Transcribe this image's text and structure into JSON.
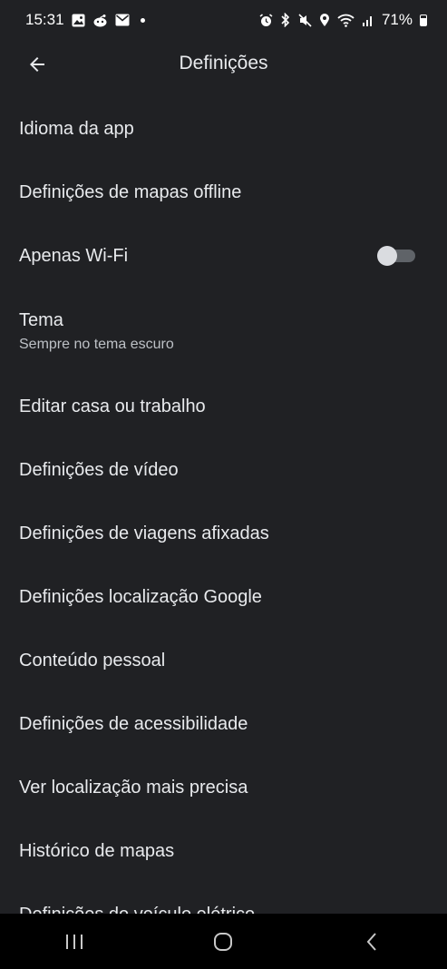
{
  "status_bar": {
    "time": "15:31",
    "battery_percent": "71%"
  },
  "app_bar": {
    "title": "Definições"
  },
  "settings": {
    "items": [
      {
        "label": "Idioma da app"
      },
      {
        "label": "Definições de mapas offline"
      },
      {
        "label": "Apenas Wi-Fi",
        "toggle_on": false
      },
      {
        "label": "Tema",
        "subtitle": "Sempre no tema escuro"
      },
      {
        "label": "Editar casa ou trabalho"
      },
      {
        "label": "Definições de vídeo"
      },
      {
        "label": "Definições de viagens afixadas"
      },
      {
        "label": "Definições localização Google"
      },
      {
        "label": "Conteúdo pessoal"
      },
      {
        "label": "Definições de acessibilidade"
      },
      {
        "label": "Ver localização mais precisa"
      },
      {
        "label": "Histórico de mapas"
      },
      {
        "label": "Definições do veículo elétrico"
      }
    ]
  },
  "colors": {
    "background": "#202124",
    "text_primary": "#e8eaed",
    "text_secondary": "#bdc1c6",
    "nav_bar": "#000000"
  }
}
